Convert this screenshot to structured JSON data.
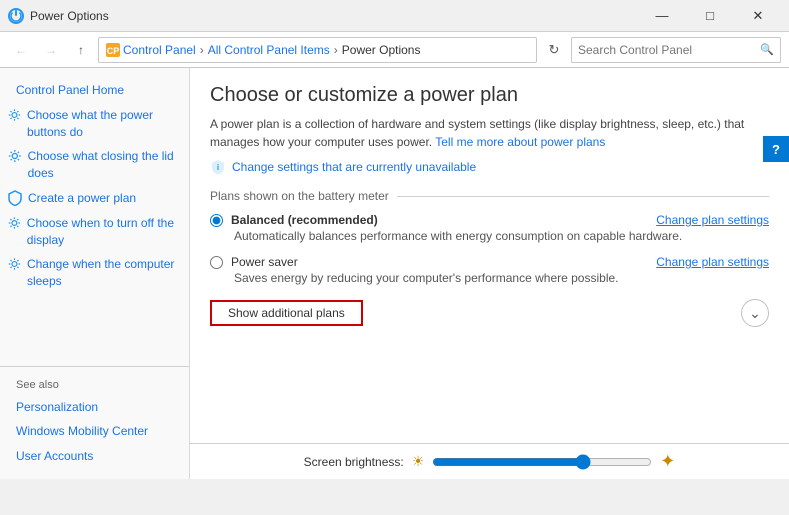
{
  "titleBar": {
    "title": "Power Options",
    "controls": {
      "minimize": "—",
      "maximize": "□",
      "close": "✕"
    }
  },
  "addressBar": {
    "breadcrumbs": [
      "Control Panel",
      "All Control Panel Items",
      "Power Options"
    ],
    "searchPlaceholder": "Search Control Panel"
  },
  "sidebar": {
    "links": [
      {
        "id": "control-panel-home",
        "label": "Control Panel Home",
        "link": true
      },
      {
        "id": "power-buttons",
        "label": "Choose what the power buttons do",
        "link": true,
        "icon": "gear"
      },
      {
        "id": "lid-action",
        "label": "Choose what closing the lid does",
        "link": true,
        "icon": "gear"
      },
      {
        "id": "create-plan",
        "label": "Create a power plan",
        "link": true,
        "icon": "shield"
      },
      {
        "id": "turn-off-display",
        "label": "Choose when to turn off the display",
        "link": true,
        "icon": "gear"
      },
      {
        "id": "sleep-settings",
        "label": "Change when the computer sleeps",
        "link": true,
        "icon": "gear"
      }
    ],
    "seeAlso": {
      "title": "See also",
      "items": [
        "Personalization",
        "Windows Mobility Center",
        "User Accounts"
      ]
    }
  },
  "content": {
    "title": "Choose or customize a power plan",
    "description": "A power plan is a collection of hardware and system settings (like display brightness, sleep, etc.) that manages how your computer uses power.",
    "learnMore": "Tell me more about power plans",
    "shieldLink": "Change settings that are currently unavailable",
    "sectionTitle": "Plans shown on the battery meter",
    "plans": [
      {
        "id": "balanced",
        "name": "Balanced (recommended)",
        "description": "Automatically balances performance with energy consumption on capable hardware.",
        "selected": true,
        "changeLabel": "Change plan settings"
      },
      {
        "id": "power-saver",
        "name": "Power saver",
        "description": "Saves energy by reducing your computer's performance where possible.",
        "selected": false,
        "changeLabel": "Change plan settings"
      }
    ],
    "showAdditionalPlans": "Show additional plans"
  },
  "bottomBar": {
    "label": "Screen brightness:"
  }
}
